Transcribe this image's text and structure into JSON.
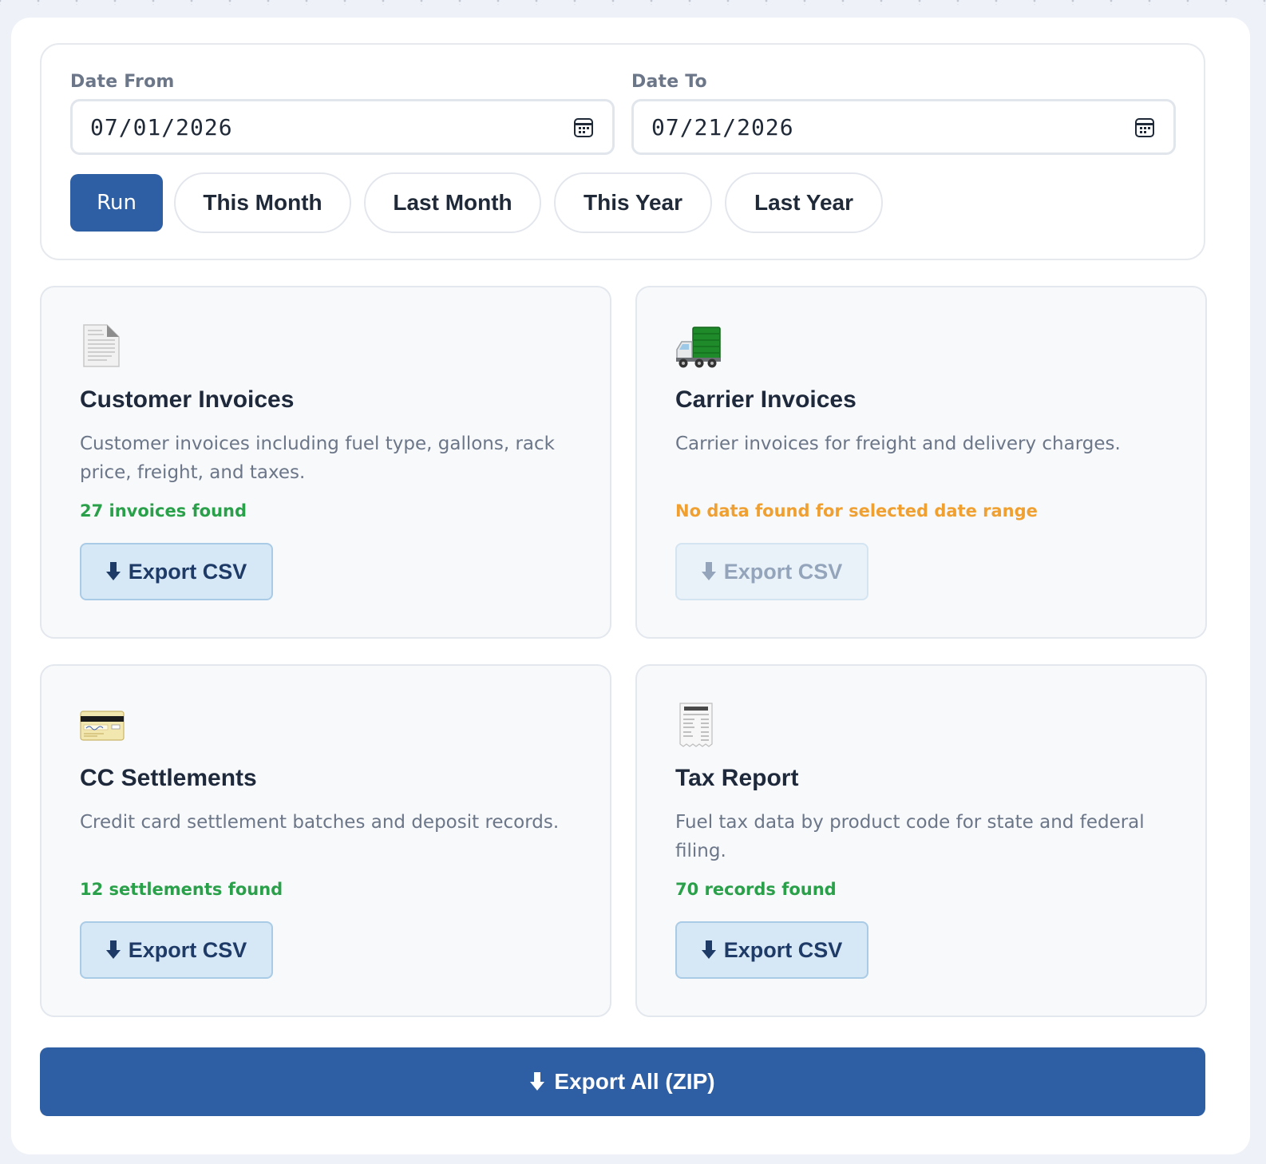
{
  "filters": {
    "date_from_label": "Date From",
    "date_from_value": "07/01/2026",
    "date_to_label": "Date To",
    "date_to_value": "07/21/2026",
    "run_label": "Run",
    "presets": [
      "This Month",
      "Last Month",
      "This Year",
      "Last Year"
    ]
  },
  "cards": [
    {
      "icon": "document-icon",
      "title": "Customer Invoices",
      "description": "Customer invoices including fuel type, gallons, rack price, freight, and taxes.",
      "status": "27 invoices found",
      "status_type": "ok",
      "export_label": "Export CSV",
      "export_enabled": true
    },
    {
      "icon": "delivery-truck-icon",
      "title": "Carrier Invoices",
      "description": "Carrier invoices for freight and delivery charges.",
      "status": "No data found for selected date range",
      "status_type": "warning",
      "export_label": "Export CSV",
      "export_enabled": false
    },
    {
      "icon": "credit-card-icon",
      "title": "CC Settlements",
      "description": "Credit card settlement batches and deposit records.",
      "status": "12 settlements found",
      "status_type": "ok",
      "export_label": "Export CSV",
      "export_enabled": true
    },
    {
      "icon": "receipt-icon",
      "title": "Tax Report",
      "description": "Fuel tax data by product code for state and federal filing.",
      "status": "70 records found",
      "status_type": "ok",
      "export_label": "Export CSV",
      "export_enabled": true
    }
  ],
  "export_all_label": "Export All (ZIP)",
  "colors": {
    "primary": "#2e5ea3",
    "success": "#2aa04a",
    "warning": "#f0a030",
    "export_button_bg": "#d6e7f5"
  }
}
